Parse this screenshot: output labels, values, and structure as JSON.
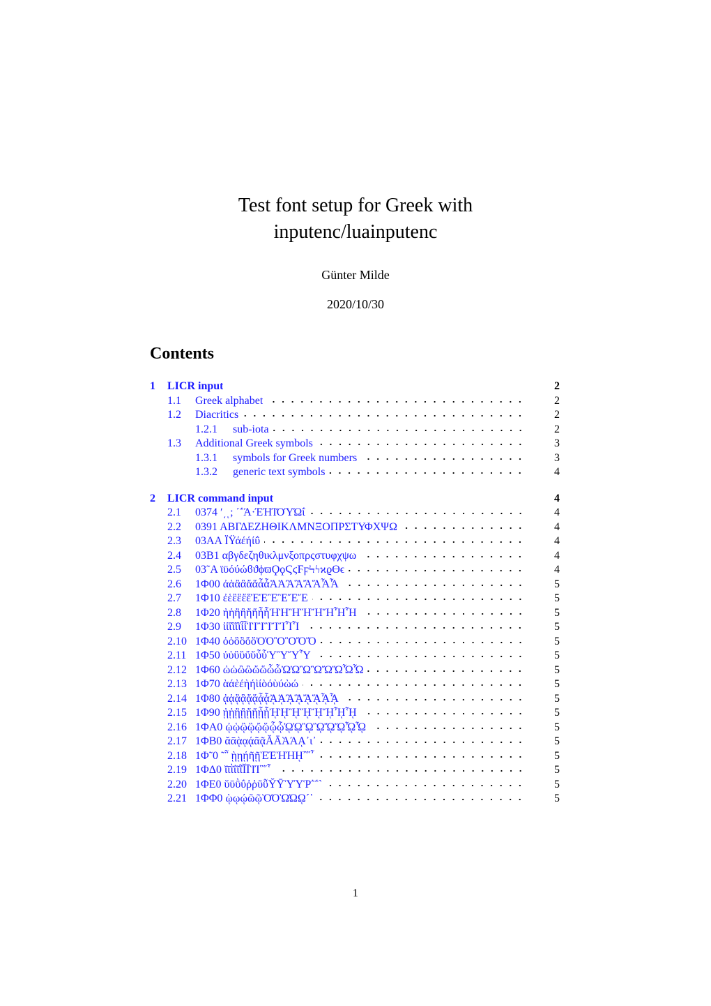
{
  "title_lines": [
    "Test font setup for Greek with",
    "inputenc/luainputenc"
  ],
  "author": "Günter Milde",
  "date": "2020/10/30",
  "contents_heading": "Contents",
  "toc": [
    {
      "level": "sec",
      "num": "1",
      "title": "LICR input",
      "page": "2"
    },
    {
      "level": "sub",
      "num": "1.1",
      "title": "Greek alphabet",
      "page": "2"
    },
    {
      "level": "sub",
      "num": "1.2",
      "title": "Diacritics",
      "page": "2"
    },
    {
      "level": "subsub",
      "num": "1.2.1",
      "title": "sub-iota",
      "page": "2"
    },
    {
      "level": "sub",
      "num": "1.3",
      "title": "Additional Greek symbols",
      "page": "3"
    },
    {
      "level": "subsub",
      "num": "1.3.1",
      "title": "symbols for Greek numbers",
      "page": "3"
    },
    {
      "level": "subsub",
      "num": "1.3.2",
      "title": "generic text symbols",
      "page": "4"
    },
    {
      "level": "sec",
      "num": "2",
      "title": "LICR command input",
      "page": "4"
    },
    {
      "level": "sub",
      "num": "2.1",
      "title": "0374 ʹ͵ͺ; ΄΅Ά·ΈΉΊΌΎΏΐ",
      "page": "4"
    },
    {
      "level": "sub",
      "num": "2.2",
      "title": "0391 ΑΒΓΔΕΖΗΘΙΚΛΜΝΞΟΠΡΣΤΥΦΧΨΩ",
      "page": "4"
    },
    {
      "level": "sub",
      "num": "2.3",
      "title": "03AA ΪΫάέήίΰ",
      "page": "4"
    },
    {
      "level": "sub",
      "num": "2.4",
      "title": "03B1 αβγδεζηθικλμνξοπρςστυφχψω",
      "page": "4"
    },
    {
      "level": "sub",
      "num": "2.5",
      "title": "03˜A ϊϋόύώϐϑϕϖϘϙϚϛϜϝϞϟϰϱϴϵ",
      "page": "4"
    },
    {
      "level": "sub",
      "num": "2.6",
      "title": "1Φ00 ἀἁἂἃἄἅἆἇἈἉἊἋἌἍἎἏ",
      "page": "5"
    },
    {
      "level": "sub",
      "num": "2.7",
      "title": "1Φ10 ἐἑἒἓἔἕἘἙἚἛἜἝ",
      "page": "5"
    },
    {
      "level": "sub",
      "num": "2.8",
      "title": "1Φ20 ἠἡἢἣἤἥἦἧἨἩἪἫἬἭἮἯ",
      "page": "5"
    },
    {
      "level": "sub",
      "num": "2.9",
      "title": "1Φ30 ἰἱἲἳἴἵἶἷἸἹἺἻἼἽἾἿ",
      "page": "5"
    },
    {
      "level": "sub",
      "num": "2.10",
      "title": "1Φ40 ὀὁὂὃὄὅὈὉὊὋὌὍ",
      "page": "5"
    },
    {
      "level": "sub",
      "num": "2.11",
      "title": "1Φ50 ὐὑὒὓὔὕὖὗὙὛὝὟ",
      "page": "5"
    },
    {
      "level": "sub",
      "num": "2.12",
      "title": "1Φ60 ὠὡὢὣὤὥὦὧὨὩὪὫὬὭὮὯ",
      "page": "5"
    },
    {
      "level": "sub",
      "num": "2.13",
      "title": "1Φ70 ὰάὲέὴήὶίὸόὺύὼώ",
      "page": "5"
    },
    {
      "level": "sub",
      "num": "2.14",
      "title": "1Φ80 ᾀᾁᾂᾃᾄᾅᾆᾇᾈᾉᾊᾋᾌᾍᾎᾏ",
      "page": "5"
    },
    {
      "level": "sub",
      "num": "2.15",
      "title": "1Φ90 ᾐᾑᾒᾓᾔᾕᾖᾗᾘᾙᾚᾛᾜᾝᾞᾟ",
      "page": "5"
    },
    {
      "level": "sub",
      "num": "2.16",
      "title": "1ΦA0 ᾠᾡᾢᾣᾤᾥᾦᾧᾨᾩᾪᾫᾬᾭᾮᾯ",
      "page": "5"
    },
    {
      "level": "sub",
      "num": "2.17",
      "title": "1ΦB0 ᾰᾱᾲᾳᾴᾶᾷᾸᾹᾺΆᾼ᾽ι᾿",
      "page": "5"
    },
    {
      "level": "sub",
      "num": "2.18",
      "title": "1Φ˜0 ῀῁ ῂῃῄῆῇῈΈῊΉῌ῍῎῏",
      "page": "5"
    },
    {
      "level": "sub",
      "num": "2.19",
      "title": "1ΦΔ0 ῐῑῒΐῖῗῘῙῚΊ῝῞῟",
      "page": "5"
    },
    {
      "level": "sub",
      "num": "2.20",
      "title": "1ΦE0 ῠῡῢΰῤῥῦῧῨῩῪΎῬ῭΅`",
      "page": "5"
    },
    {
      "level": "sub",
      "num": "2.21",
      "title": "1ΦΦ0 ῲῳῴῶῷῸΌῺΏῼ´῾",
      "page": "5"
    }
  ],
  "page_number": "1",
  "link_color": "#1a1aff"
}
